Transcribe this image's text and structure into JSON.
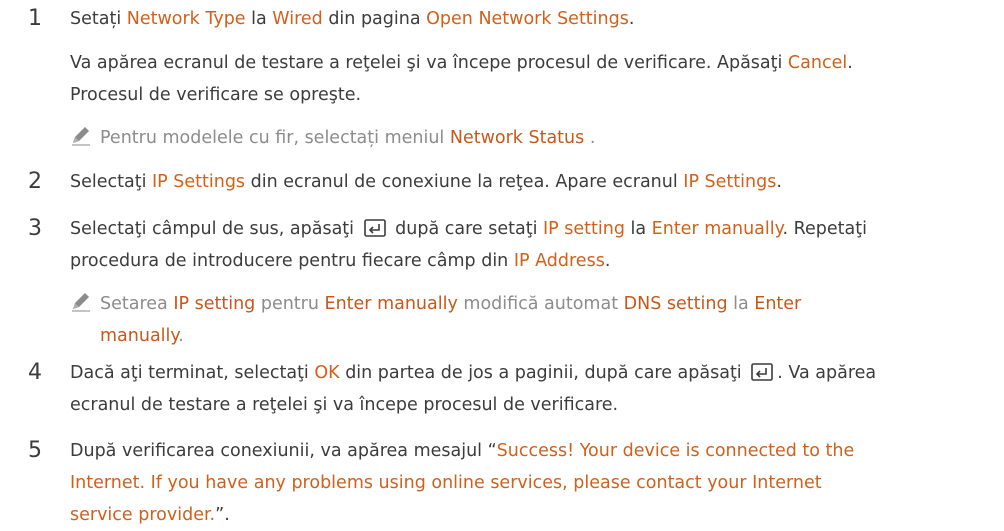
{
  "steps": {
    "s1": {
      "num": "1",
      "a": "Setați ",
      "b": "Network Type",
      "c": " la ",
      "d": "Wired",
      "e": " din pagina ",
      "f": "Open Network Settings",
      "g": ".",
      "p2a": "Va apărea ecranul de testare a reţelei şi va începe procesul de verificare. Apăsaţi ",
      "p2b": "Cancel",
      "p2c": ".",
      "p2d": "Procesul de verificare se opreşte.",
      "note_a": "Pentru modelele cu fir, selectați meniul ",
      "note_b": "Network Status",
      "note_c": " ."
    },
    "s2": {
      "num": "2",
      "a": "Selectaţi ",
      "b": "IP Settings",
      "c": " din ecranul de conexiune la reţea. Apare ecranul ",
      "d": "IP Settings",
      "e": "."
    },
    "s3": {
      "num": "3",
      "a": "Selectaţi câmpul de sus, apăsaţi ",
      "b": " după care setaţi ",
      "c": "IP setting",
      "d": " la ",
      "e": "Enter manually",
      "f": ". Repetaţi",
      "l2a": "procedura de introducere pentru fiecare câmp din ",
      "l2b": "IP Address",
      "l2c": ".",
      "note_a": "Setarea ",
      "note_b": "IP setting",
      "note_c": " pentru ",
      "note_d": "Enter manually",
      "note_e": " modifică automat ",
      "note_f": "DNS setting",
      "note_g": " la ",
      "note_h": "Enter",
      "note_i": "manually",
      "note_j": "."
    },
    "s4": {
      "num": "4",
      "a": "Dacă aţi terminat, selectaţi ",
      "b": "OK",
      "c": " din partea de jos a paginii, după care apăsaţi ",
      "d": ". Va apărea",
      "l2": "ecranul de testare a reţelei şi va începe procesul de verificare."
    },
    "s5": {
      "num": "5",
      "a": "După verificarea conexiunii, va apărea mesajul “",
      "b": "Success! Your device is connected to the",
      "l2": "Internet. If you have any problems using online services, please contact your Internet",
      "l3": "service provider.",
      "c": "”."
    }
  },
  "icons": {
    "note_icon": "pencil-icon",
    "enter_icon": "enter-key-icon"
  },
  "colors": {
    "highlight": "#d2601a",
    "text": "#3c3c3c",
    "note": "#8c8c8c"
  }
}
